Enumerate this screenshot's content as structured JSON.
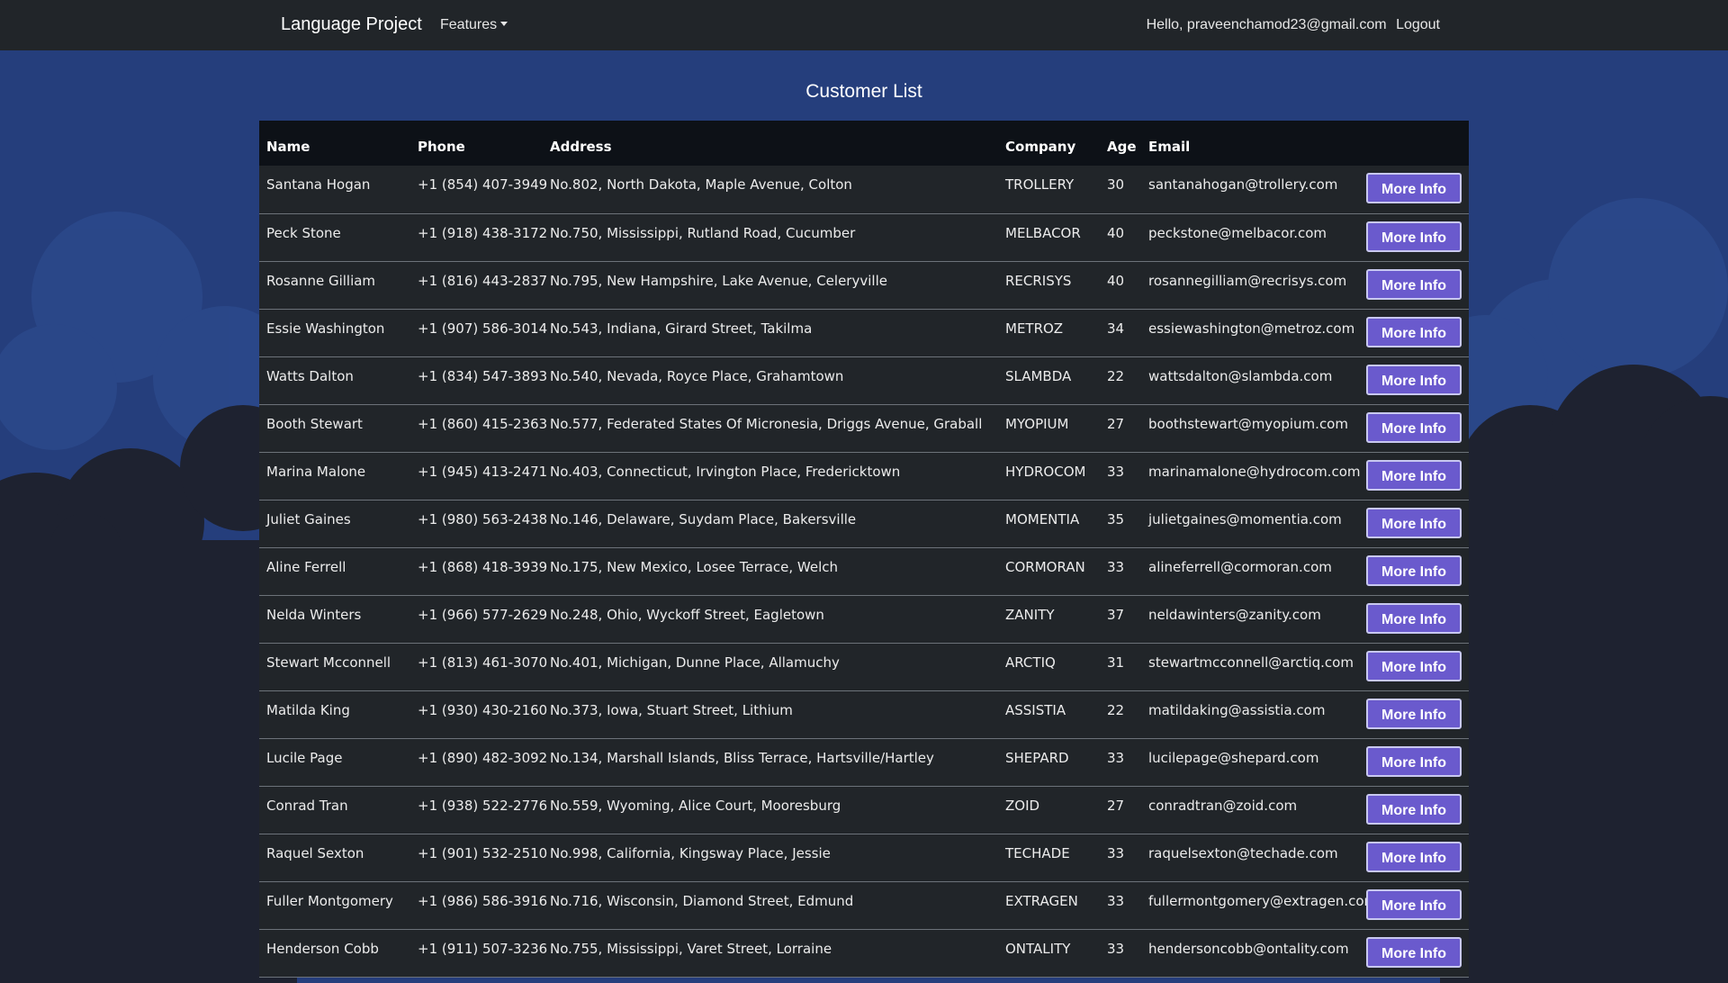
{
  "navbar": {
    "brand": "Language Project",
    "features_label": "Features",
    "greeting": "Hello, praveenchamod23@gmail.com",
    "logout_label": "Logout"
  },
  "page": {
    "title": "Customer List"
  },
  "table": {
    "columns": [
      "Name",
      "Phone",
      "Address",
      "Company",
      "Age",
      "Email",
      ""
    ],
    "button_label": "More Info",
    "rows": [
      {
        "name": "Santana Hogan",
        "phone": "+1 (854) 407-3949",
        "address": "No.802, North Dakota, Maple Avenue, Colton",
        "company": "TROLLERY",
        "age": "30",
        "email": "santanahogan@trollery.com"
      },
      {
        "name": "Peck Stone",
        "phone": "+1 (918) 438-3172",
        "address": "No.750, Mississippi, Rutland Road, Cucumber",
        "company": "MELBACOR",
        "age": "40",
        "email": "peckstone@melbacor.com"
      },
      {
        "name": "Rosanne Gilliam",
        "phone": "+1 (816) 443-2837",
        "address": "No.795, New Hampshire, Lake Avenue, Celeryville",
        "company": "RECRISYS",
        "age": "40",
        "email": "rosannegilliam@recrisys.com"
      },
      {
        "name": "Essie Washington",
        "phone": "+1 (907) 586-3014",
        "address": "No.543, Indiana, Girard Street, Takilma",
        "company": "METROZ",
        "age": "34",
        "email": "essiewashington@metroz.com"
      },
      {
        "name": "Watts Dalton",
        "phone": "+1 (834) 547-3893",
        "address": "No.540, Nevada, Royce Place, Grahamtown",
        "company": "SLAMBDA",
        "age": "22",
        "email": "wattsdalton@slambda.com"
      },
      {
        "name": "Booth Stewart",
        "phone": "+1 (860) 415-2363",
        "address": "No.577, Federated States Of Micronesia, Driggs Avenue, Graball",
        "company": "MYOPIUM",
        "age": "27",
        "email": "boothstewart@myopium.com"
      },
      {
        "name": "Marina Malone",
        "phone": "+1 (945) 413-2471",
        "address": "No.403, Connecticut, Irvington Place, Fredericktown",
        "company": "HYDROCOM",
        "age": "33",
        "email": "marinamalone@hydrocom.com"
      },
      {
        "name": "Juliet Gaines",
        "phone": "+1 (980) 563-2438",
        "address": "No.146, Delaware, Suydam Place, Bakersville",
        "company": "MOMENTIA",
        "age": "35",
        "email": "julietgaines@momentia.com"
      },
      {
        "name": "Aline Ferrell",
        "phone": "+1 (868) 418-3939",
        "address": "No.175, New Mexico, Losee Terrace, Welch",
        "company": "CORMORAN",
        "age": "33",
        "email": "alineferrell@cormoran.com"
      },
      {
        "name": "Nelda Winters",
        "phone": "+1 (966) 577-2629",
        "address": "No.248, Ohio, Wyckoff Street, Eagletown",
        "company": "ZANITY",
        "age": "37",
        "email": "neldawinters@zanity.com"
      },
      {
        "name": "Stewart Mcconnell",
        "phone": "+1 (813) 461-3070",
        "address": "No.401, Michigan, Dunne Place, Allamuchy",
        "company": "ARCTIQ",
        "age": "31",
        "email": "stewartmcconnell@arctiq.com"
      },
      {
        "name": "Matilda King",
        "phone": "+1 (930) 430-2160",
        "address": "No.373, Iowa, Stuart Street, Lithium",
        "company": "ASSISTIA",
        "age": "22",
        "email": "matildaking@assistia.com"
      },
      {
        "name": "Lucile Page",
        "phone": "+1 (890) 482-3092",
        "address": "No.134, Marshall Islands, Bliss Terrace, Hartsville/Hartley",
        "company": "SHEPARD",
        "age": "33",
        "email": "lucilepage@shepard.com"
      },
      {
        "name": "Conrad Tran",
        "phone": "+1 (938) 522-2776",
        "address": "No.559, Wyoming, Alice Court, Mooresburg",
        "company": "ZOID",
        "age": "27",
        "email": "conradtran@zoid.com"
      },
      {
        "name": "Raquel Sexton",
        "phone": "+1 (901) 532-2510",
        "address": "No.998, California, Kingsway Place, Jessie",
        "company": "TECHADE",
        "age": "33",
        "email": "raquelsexton@techade.com"
      },
      {
        "name": "Fuller Montgomery",
        "phone": "+1 (986) 586-3916",
        "address": "No.716, Wisconsin, Diamond Street, Edmund",
        "company": "EXTRAGEN",
        "age": "33",
        "email": "fullermontgomery@extragen.com"
      },
      {
        "name": "Henderson Cobb",
        "phone": "+1 (911) 507-3236",
        "address": "No.755, Mississippi, Varet Street, Lorraine",
        "company": "ONTALITY",
        "age": "33",
        "email": "hendersoncobb@ontality.com"
      }
    ]
  },
  "colors": {
    "navbar": "#212529",
    "background_top": "#253e7c",
    "background_bottom": "#1e2230",
    "button": "#6a5acd"
  }
}
